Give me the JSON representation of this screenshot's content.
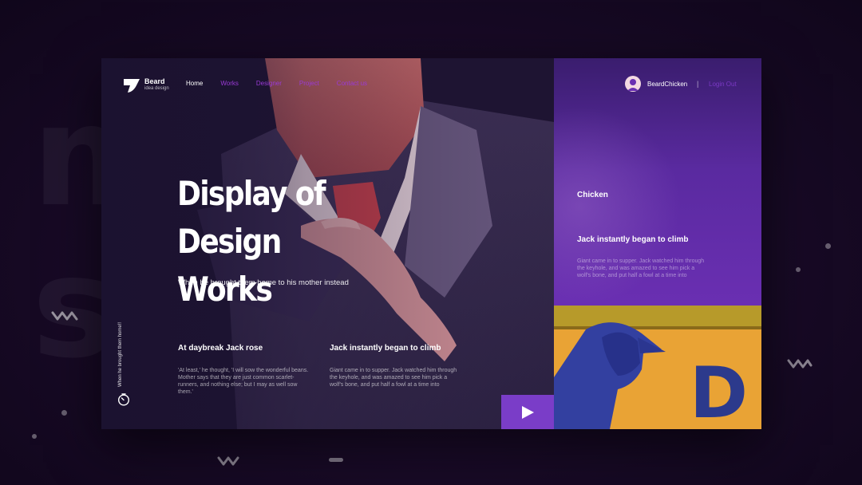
{
  "background": {
    "word_top": "moment",
    "word_bottom": "s"
  },
  "brand": {
    "name": "Beard",
    "tagline": "idea design"
  },
  "nav": {
    "items": [
      {
        "label": "Home",
        "active": true
      },
      {
        "label": "Works",
        "active": false
      },
      {
        "label": "Designer",
        "active": false
      },
      {
        "label": "Project",
        "active": false
      },
      {
        "label": "Contact us",
        "active": false
      }
    ]
  },
  "user": {
    "name": "BeardChicken",
    "separator": "|",
    "logout_label": "Login Out"
  },
  "hero": {
    "title_line1": "Display of Design",
    "title_line2": "Works",
    "subtitle": "When he brought them home to his mother instead",
    "vertical_text": "When he brought them home!!"
  },
  "columns": [
    {
      "title": "At daybreak Jack rose",
      "body": "'At least,' he thought, 'I will sow the wonderful beans. Mother says that they are just common scarlet-runners, and nothing else; but I may as well sow them.'"
    },
    {
      "title": "Jack instantly began to climb",
      "body": "Giant came in to supper. Jack watched him through the keyhole, and was amazed to see him pick a wolf's bone, and put half a fowl at a time into"
    }
  ],
  "right_panel": {
    "label": "Chicken",
    "title": "Jack instantly began to climb",
    "body": "Giant came in to supper. Jack watched him through the keyhole, and was amazed to see him pick a wolf's bone, and put half a fowl at a time into"
  },
  "thumbnail": {
    "letter": "D"
  },
  "colors": {
    "accent_purple": "#7a3dc8",
    "nav_inactive": "#9a3ad6",
    "thumb_yellow": "#e9a335",
    "thumb_blue": "#2c3a8c"
  },
  "icons": {
    "play": "play-icon",
    "timer": "timer-icon",
    "avatar": "avatar-icon"
  }
}
